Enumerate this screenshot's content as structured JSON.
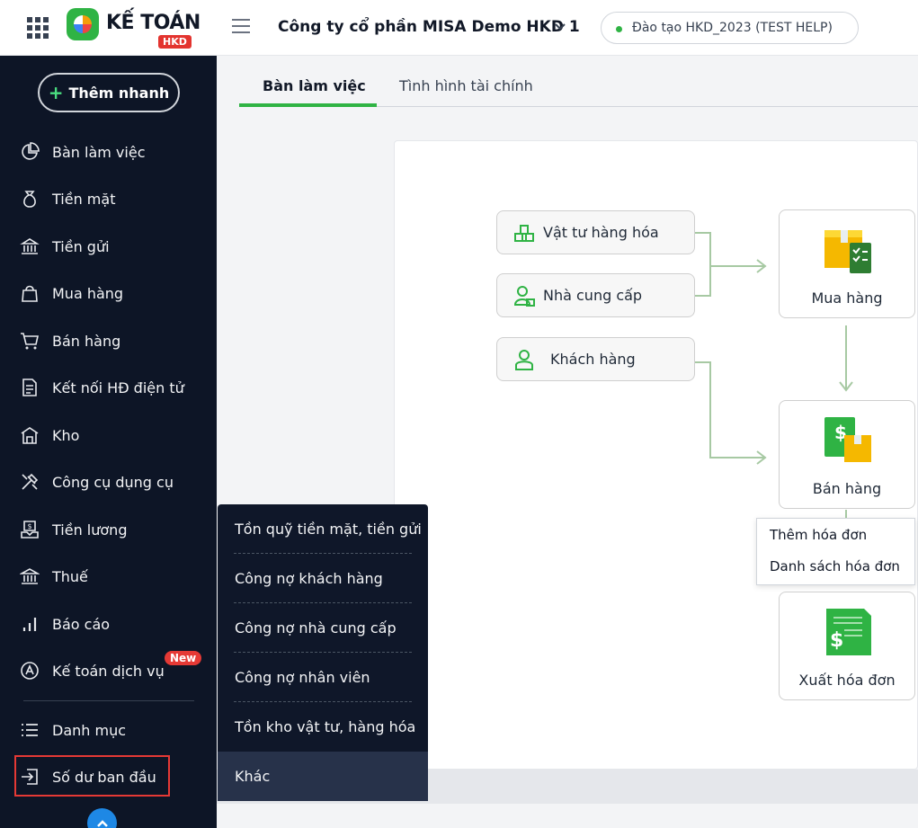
{
  "header": {
    "logo_text": "KẾ TOÁN",
    "logo_badge": "HKD",
    "company_name": "Công ty cổ phần MISA Demo HKD 1",
    "environment": "Đào tạo HKD_2023 (TEST HELP)"
  },
  "sidebar": {
    "add_button": "Thêm nhanh",
    "items": [
      {
        "label": "Bàn làm việc",
        "icon": "dashboard-icon"
      },
      {
        "label": "Tiền mặt",
        "icon": "money-bag-icon"
      },
      {
        "label": "Tiền gửi",
        "icon": "bank-deposit-icon"
      },
      {
        "label": "Mua hàng",
        "icon": "shopping-bag-icon"
      },
      {
        "label": "Bán hàng",
        "icon": "cart-icon"
      },
      {
        "label": "Kết nối HĐ điện tử",
        "icon": "e-invoice-icon"
      },
      {
        "label": "Kho",
        "icon": "warehouse-icon"
      },
      {
        "label": "Công cụ dụng cụ",
        "icon": "tools-icon"
      },
      {
        "label": "Tiền lương",
        "icon": "payroll-icon"
      },
      {
        "label": "Thuế",
        "icon": "tax-icon"
      },
      {
        "label": "Báo cáo",
        "icon": "report-icon"
      },
      {
        "label": "Kế toán dịch vụ",
        "icon": "accounting-service-icon"
      },
      {
        "label": "Danh mục",
        "icon": "list-icon"
      },
      {
        "label": "Số dư ban đầu",
        "icon": "opening-balance-icon"
      }
    ],
    "new_badge": "New"
  },
  "tabs": [
    {
      "label": "Bàn làm việc",
      "active": true
    },
    {
      "label": "Tình hình tài chính",
      "active": false
    }
  ],
  "flow": {
    "pills": [
      "Vật tư hàng hóa",
      "Nhà cung cấp",
      "Khách hàng"
    ],
    "cards": [
      "Mua hàng",
      "Bán hàng",
      "Xuất hóa đơn"
    ],
    "sales_menu": [
      "Thêm hóa đơn",
      "Danh sách hóa đơn"
    ]
  },
  "flyout": {
    "items": [
      "Tồn quỹ tiền mặt, tiền gửi",
      "Công nợ khách hàng",
      "Công nợ nhà cung cấp",
      "Công nợ nhân viên",
      "Tồn kho vật tư, hàng hóa",
      "Khác"
    ],
    "active_index": 5
  },
  "colors": {
    "sidebar_bg": "#0d1526",
    "accent_green": "#2fb344",
    "badge_red": "#e53935",
    "highlight_red": "#e53935",
    "collapse_blue": "#1e88e5"
  }
}
